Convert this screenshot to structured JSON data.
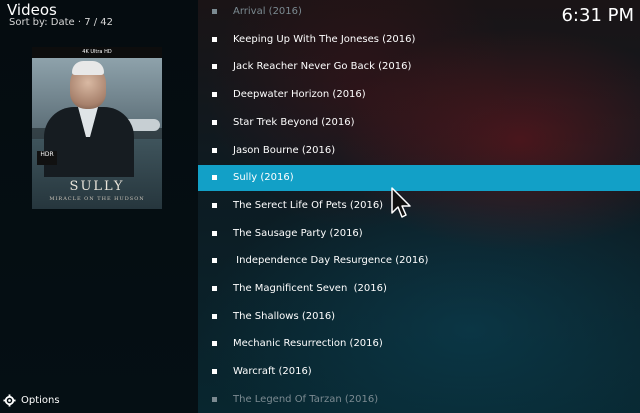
{
  "header": {
    "title": "Videos",
    "sort_info": "Sort by: Date  ·  7 / 42",
    "clock": "6:31 PM"
  },
  "poster": {
    "badge": "4K Ultra HD",
    "hdr": "HDR",
    "title": "SULLY",
    "subtitle": "MIRACLE ON THE HUDSON"
  },
  "list": {
    "items": [
      {
        "label": "Arrival (2016)",
        "state": "dim"
      },
      {
        "label": "Keeping Up With The Joneses (2016)",
        "state": "normal"
      },
      {
        "label": "Jack Reacher Never Go Back (2016)",
        "state": "normal"
      },
      {
        "label": "Deepwater Horizon (2016)",
        "state": "normal"
      },
      {
        "label": "Star Trek Beyond (2016)",
        "state": "normal"
      },
      {
        "label": "Jason Bourne (2016)",
        "state": "normal"
      },
      {
        "label": "Sully (2016)",
        "state": "selected"
      },
      {
        "label": "The Serect Life Of Pets (2016)",
        "state": "normal"
      },
      {
        "label": "The Sausage Party (2016)",
        "state": "normal"
      },
      {
        "label": " Independence Day Resurgence (2016)",
        "state": "normal"
      },
      {
        "label": "The Magnificent Seven  (2016)",
        "state": "normal"
      },
      {
        "label": "The Shallows (2016)",
        "state": "normal"
      },
      {
        "label": "Mechanic Resurrection (2016)",
        "state": "normal"
      },
      {
        "label": "Warcraft (2016)",
        "state": "normal"
      },
      {
        "label": "The Legend Of Tarzan (2016)",
        "state": "dim"
      }
    ]
  },
  "footer": {
    "options_label": "Options"
  },
  "colors": {
    "accent": "#12a0c7",
    "sidebar": "#050c10"
  }
}
